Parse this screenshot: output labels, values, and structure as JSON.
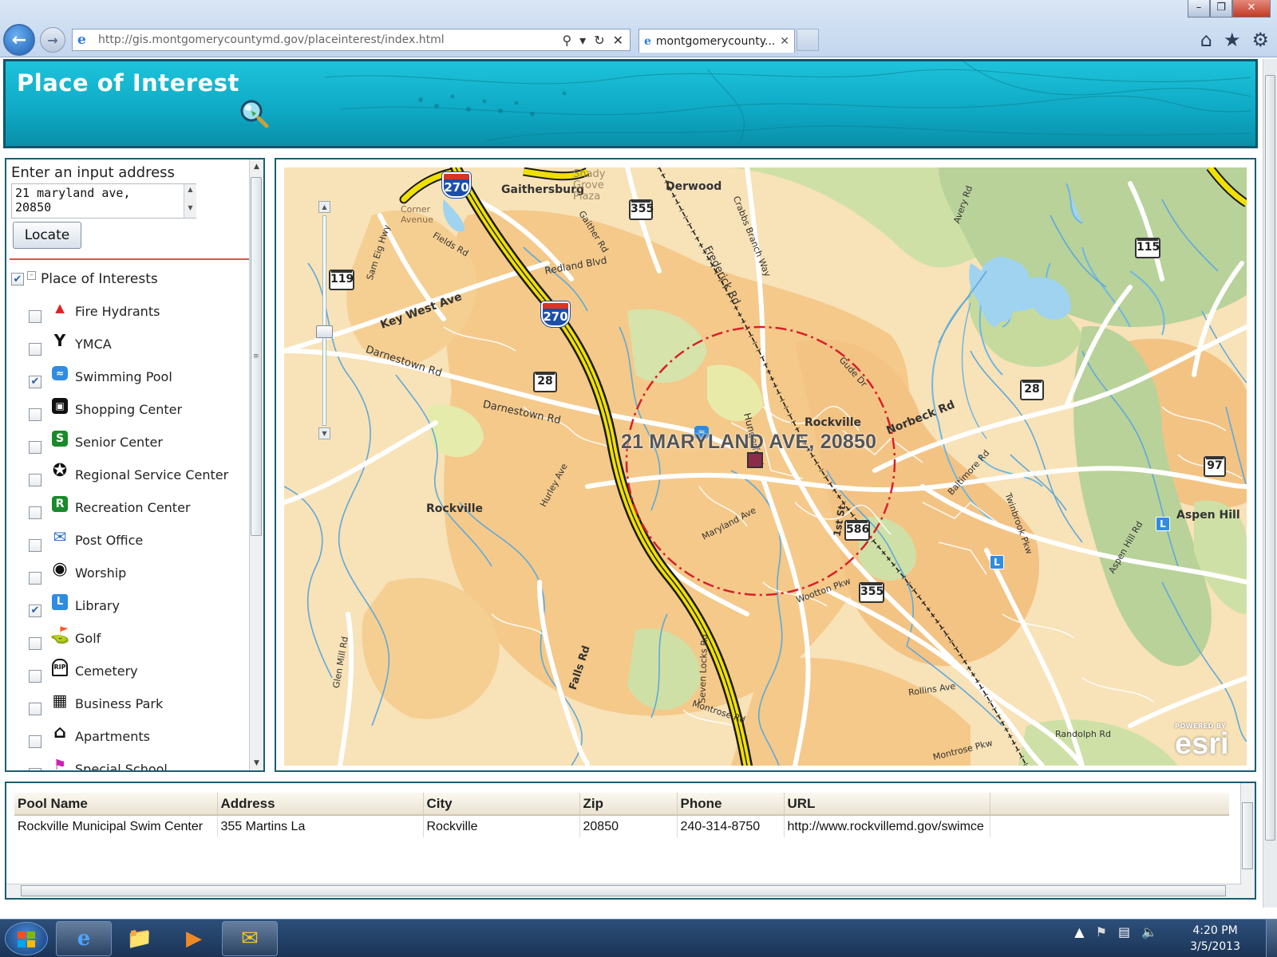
{
  "browser": {
    "url": "http://gis.montgomerycountymd.gov/placeinterest/index.html",
    "tab_title": "montgomerycounty...",
    "window_controls": {
      "minimize_icon": "minimize-icon",
      "maximize_icon": "maximize-icon",
      "close_icon": "close-icon"
    },
    "toolbar_icons": [
      "home-icon",
      "favorites-star-icon",
      "settings-gear-icon"
    ]
  },
  "page": {
    "title": "Place of Interest"
  },
  "search": {
    "label": "Enter an input address",
    "value": "21 maryland ave,\n20850",
    "locate_label": "Locate"
  },
  "layers": {
    "root_label": "Place of Interests",
    "root_checked": true,
    "items": [
      {
        "label": "Fire Hydrants",
        "checked": false,
        "icon": "fire-hydrant-icon",
        "color": "#e02020"
      },
      {
        "label": "YMCA",
        "checked": false,
        "icon": "ymca-icon",
        "color": "#111111"
      },
      {
        "label": "Swimming Pool",
        "checked": true,
        "icon": "swimming-pool-icon",
        "color": "#2f8ce0"
      },
      {
        "label": "Shopping Center",
        "checked": false,
        "icon": "shopping-center-icon",
        "color": "#111111"
      },
      {
        "label": "Senior Center",
        "checked": false,
        "icon": "senior-center-icon",
        "color": "#1a8a2a"
      },
      {
        "label": "Regional Service Center",
        "checked": false,
        "icon": "regional-service-center-icon",
        "color": "#111111"
      },
      {
        "label": "Recreation Center",
        "checked": false,
        "icon": "recreation-center-icon",
        "color": "#1a8a2a"
      },
      {
        "label": "Post Office",
        "checked": false,
        "icon": "post-office-icon",
        "color": "#2f6fd0"
      },
      {
        "label": "Worship",
        "checked": false,
        "icon": "worship-icon",
        "color": "#111111"
      },
      {
        "label": "Library",
        "checked": true,
        "icon": "library-icon",
        "color": "#2f8ce0"
      },
      {
        "label": "Golf",
        "checked": false,
        "icon": "golf-icon",
        "color": "#1a8a2a"
      },
      {
        "label": "Cemetery",
        "checked": false,
        "icon": "cemetery-icon",
        "color": "#111111"
      },
      {
        "label": "Business Park",
        "checked": false,
        "icon": "business-park-icon",
        "color": "#111111"
      },
      {
        "label": "Apartments",
        "checked": false,
        "icon": "apartments-icon",
        "color": "#111111"
      },
      {
        "label": "Special School",
        "checked": false,
        "icon": "special-school-icon",
        "color": "#d020b0"
      }
    ]
  },
  "map": {
    "location_label": "21 MARYLAND AVE, 20850",
    "place_labels": [
      "Gaithersburg",
      "Derwood",
      "Rockville",
      "Rockville",
      "Aspen Hill",
      "Shady Grove Plaza",
      "Key West Ave",
      "Darnestown Rd",
      "Darnestown Rd",
      "Norbeck Rd",
      "Frederick Rd",
      "Crabbs Branch Way",
      "Redland Blvd",
      "Gaither Rd",
      "Fields Rd",
      "Sam Eig Hwy",
      "Hurley Ave",
      "Maryland Ave",
      "Gude Dr",
      "Baltimore Rd",
      "Twinbrook Pkw",
      "Wootton Pkw",
      "Rollins Ave",
      "Randolph Rd",
      "Montrose Pkw",
      "Montrose Rd",
      "Seven Locks Rd",
      "Falls Rd",
      "Glen Mill Rd",
      "Avery Rd",
      "Aspen Hill Rd",
      "1st St",
      "Hungerford",
      "Corner Avenue"
    ],
    "route_shields": [
      "270",
      "270",
      "355",
      "355",
      "119",
      "28",
      "28",
      "586",
      "115",
      "97"
    ],
    "attribution_powered": "POWERED BY",
    "attribution_brand": "esri"
  },
  "results": {
    "columns": [
      "Pool Name",
      "Address",
      "City",
      "Zip",
      "Phone",
      "URL"
    ],
    "rows": [
      [
        "Rockville Municipal Swim Center",
        "355 Martins La",
        "Rockville",
        "20850",
        "240-314-8750",
        "http://www.rockvillemd.gov/swimce"
      ]
    ]
  },
  "taskbar": {
    "apps": [
      "internet-explorer-icon",
      "file-explorer-icon",
      "media-player-icon",
      "outlook-icon"
    ],
    "time": "4:20 PM",
    "date": "3/5/2013"
  }
}
